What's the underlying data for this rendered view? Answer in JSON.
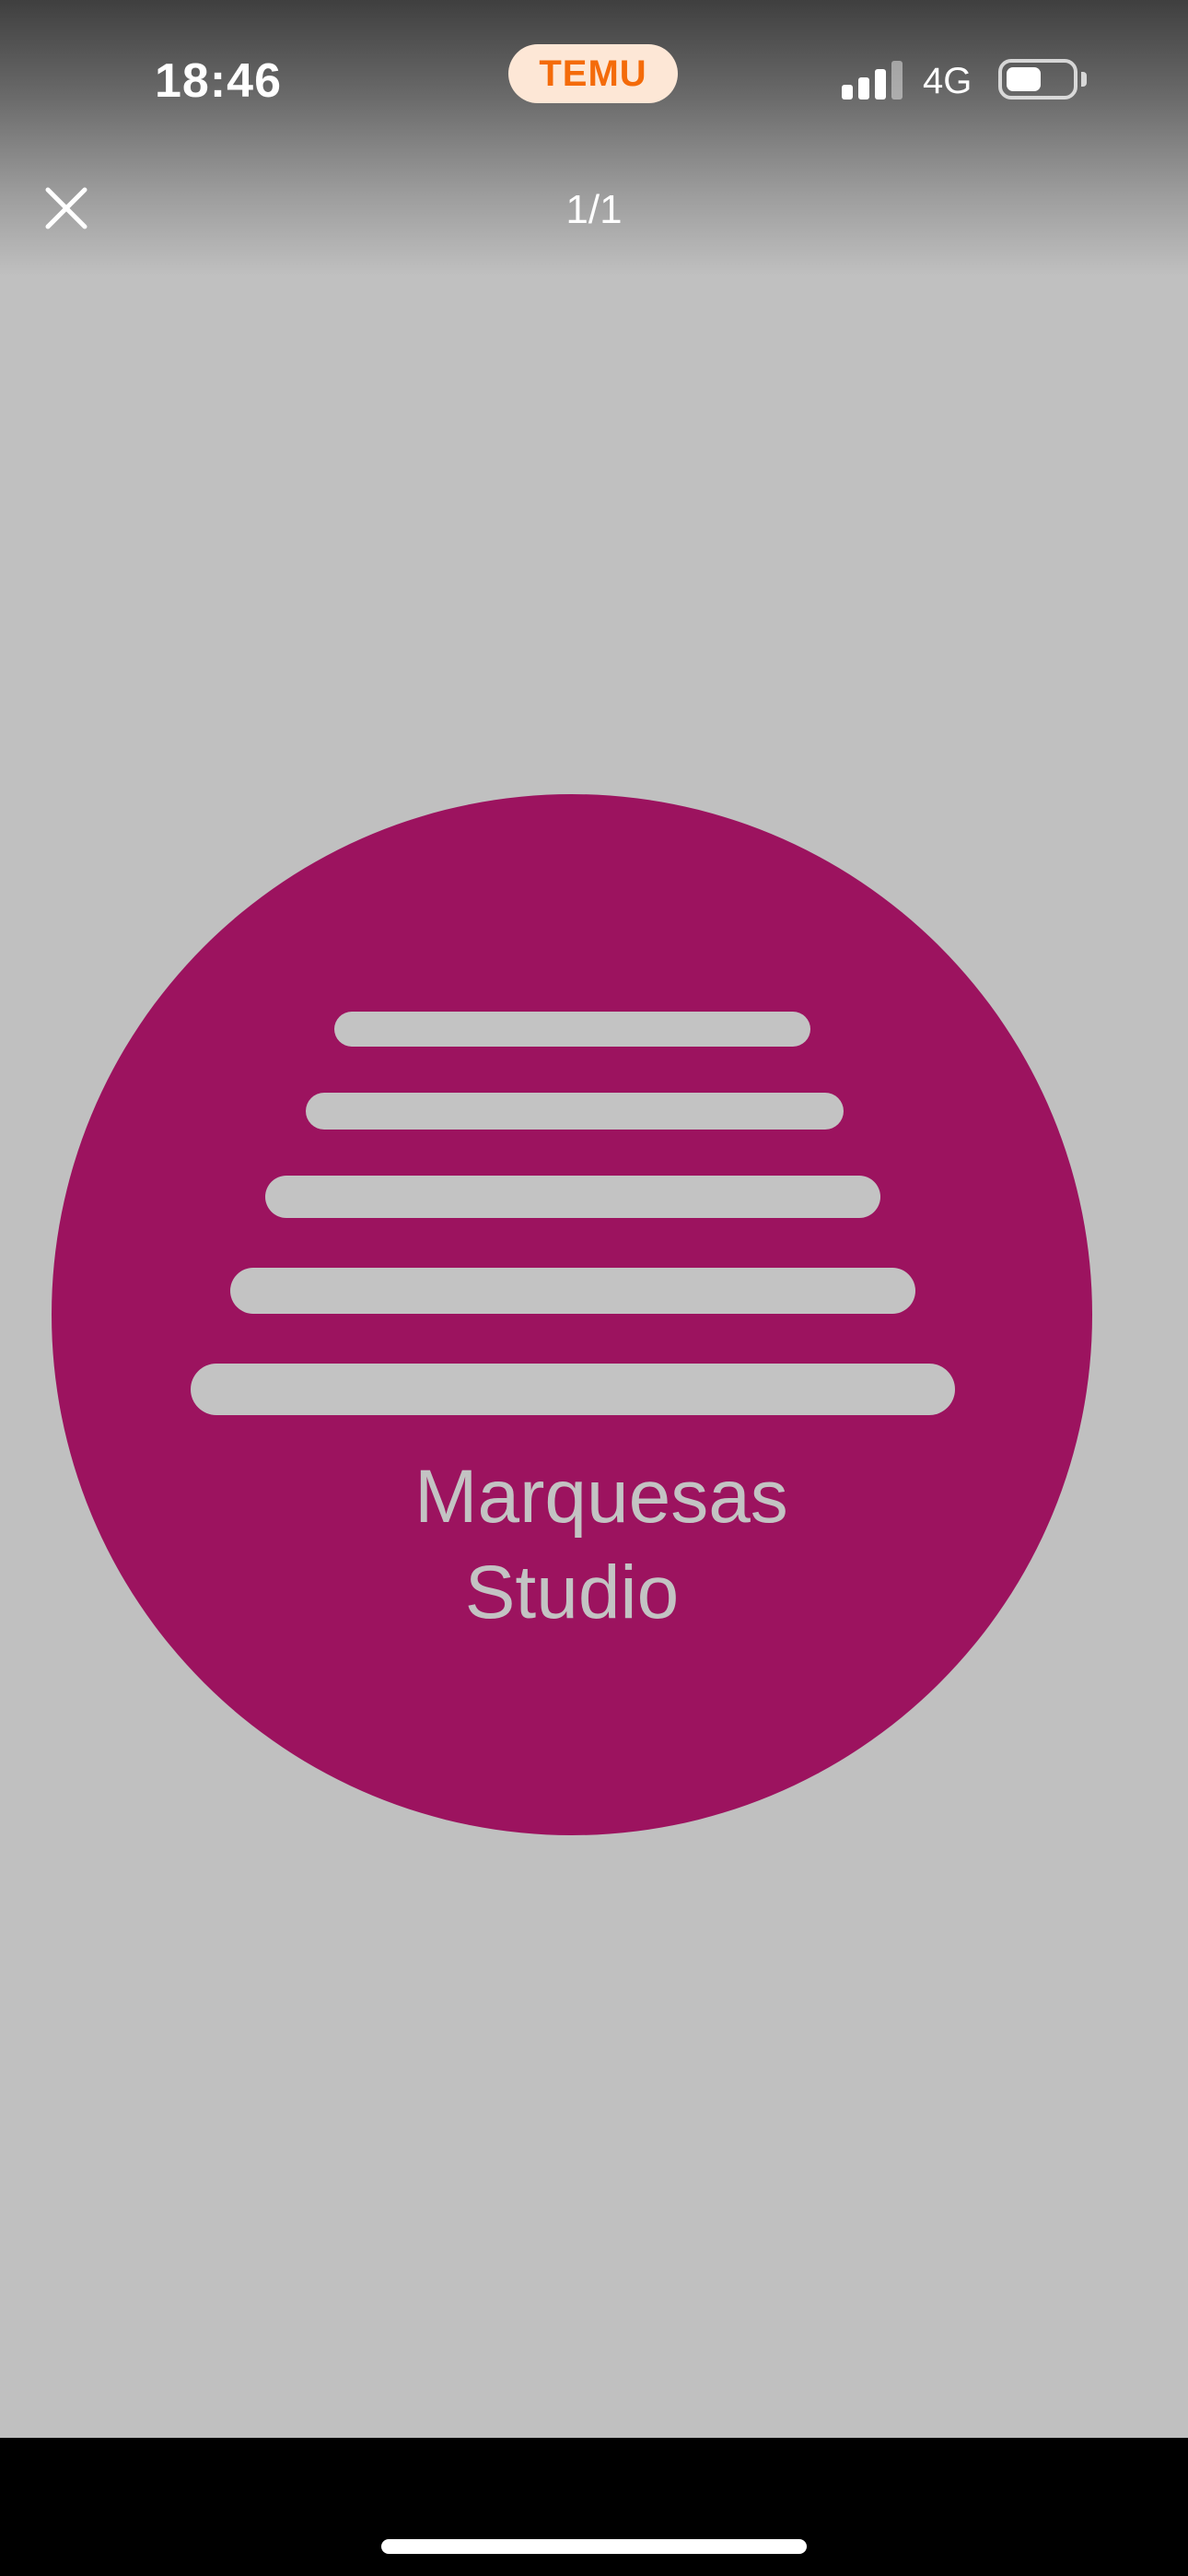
{
  "status_bar": {
    "time": "18:46",
    "app_badge": "TEMU",
    "network": "4G",
    "signal_bars_filled": 3,
    "signal_bars_total": 4,
    "battery_level": 0.55
  },
  "viewer": {
    "page_counter": "1/1",
    "close_icon": "close-icon",
    "background_color": "#c0c0c0"
  },
  "image": {
    "logo_text_line1": "Marquesas",
    "logo_text_line2": "Studio",
    "circle_color": "#9c135f",
    "stripe_color": "#c3c3c3",
    "stripe_count": 5
  }
}
